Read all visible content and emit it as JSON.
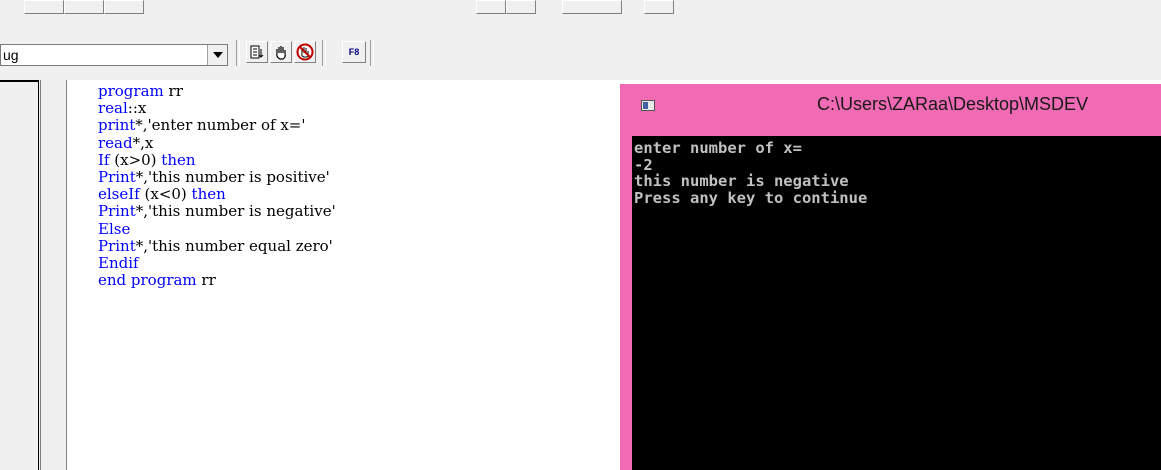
{
  "toolbar_top": {
    "icons": [
      "toolbar-button",
      "toolbar-button",
      "toolbar-button",
      "toolbar-button",
      "toolbar-button",
      "toolbar-button",
      "toolbar-button"
    ]
  },
  "toolbar": {
    "config_combo": {
      "value": "ug"
    },
    "icons": {
      "list": "list-icon",
      "hand": "hand-icon",
      "hand_stop": "hand-stop-icon",
      "f8": "F8"
    }
  },
  "editor": {
    "lines": [
      {
        "kw": "program",
        "text": " rr"
      },
      {
        "kw": "real",
        "text": "::x"
      },
      {
        "kw": "print",
        "text": "*,'enter number of x='"
      },
      {
        "kw": "read",
        "text": "*,x"
      },
      {
        "kw": "If",
        "text": " (x>0) ",
        "kw2": "then"
      },
      {
        "kw": "Print",
        "text": "*,'this number is positive'"
      },
      {
        "kw": "elseIf",
        "text": " (x<0) ",
        "kw2": "then"
      },
      {
        "kw": "Print",
        "text": "*,'this number is negative'"
      },
      {
        "kw": "Else",
        "text": ""
      },
      {
        "kw": "Print",
        "text": "*,'this number equal zero'"
      },
      {
        "kw": "Endif",
        "text": ""
      },
      {
        "kw": "end program",
        "text": " rr"
      }
    ]
  },
  "console": {
    "title": "C:\\Users\\ZARaa\\Desktop\\MSDEV",
    "output": [
      "enter number of x=",
      "-2",
      "this number is negative",
      "Press any key to continue"
    ]
  },
  "colors": {
    "console_frame": "#f06ab4",
    "keyword": "#0000ff",
    "console_bg": "#000000",
    "console_text": "#c0c0c0"
  }
}
